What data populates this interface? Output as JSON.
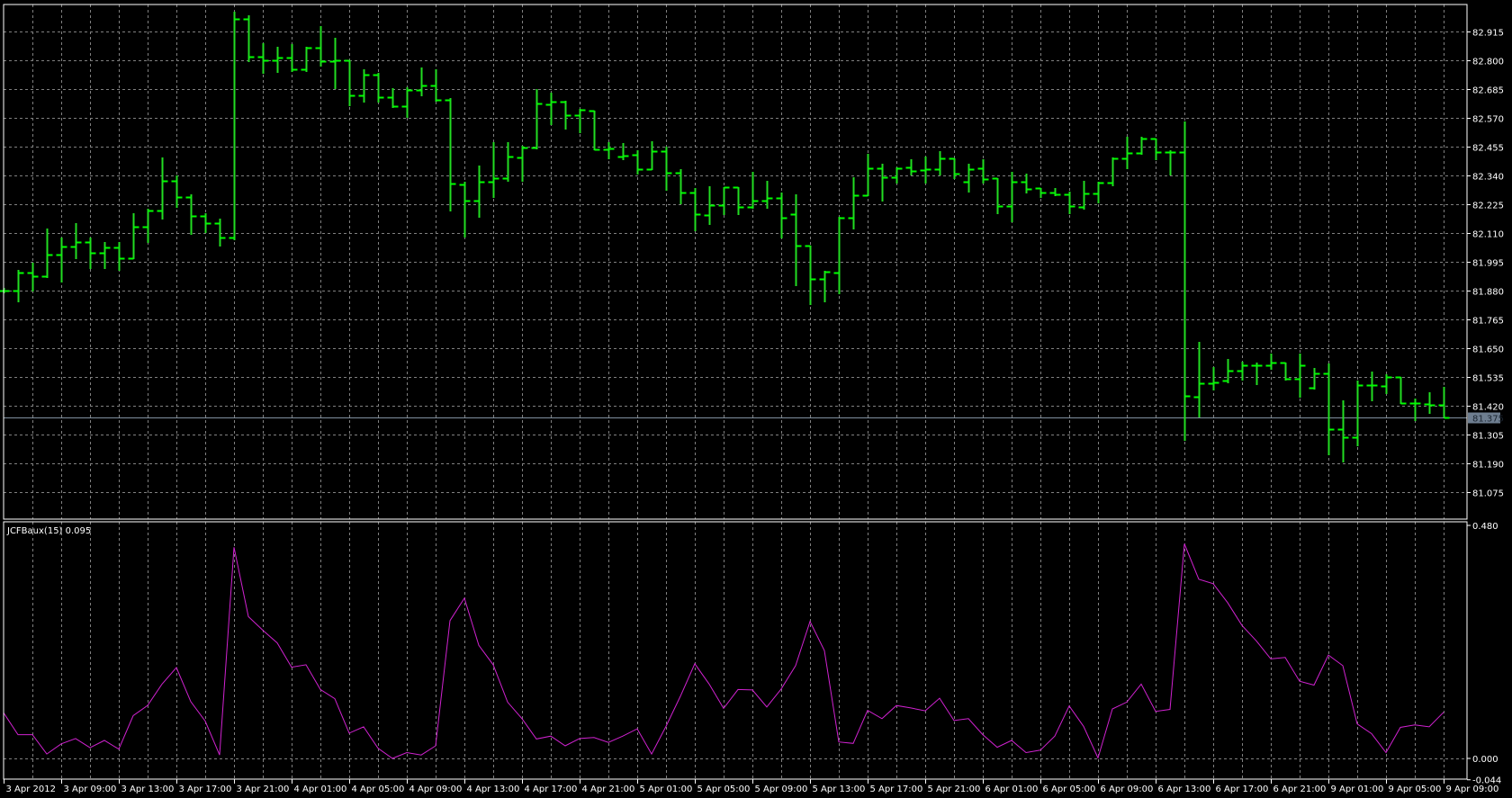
{
  "colors": {
    "background": "#000000",
    "grid": "#808080",
    "frame": "#ffffff",
    "bars": "#22dd22",
    "indicator": "#d022d0",
    "current_price_bg": "#6e7e90",
    "current_price_line": "#8090a0"
  },
  "chart_data": [
    {
      "type": "ohlc",
      "title": "",
      "price_axis": {
        "range": [
          81.0,
          82.99
        ],
        "ticks": [
          "82.915",
          "82.800",
          "82.685",
          "82.570",
          "82.455",
          "82.340",
          "82.225",
          "82.110",
          "81.995",
          "81.880",
          "81.765",
          "81.650",
          "81.535",
          "81.420",
          "81.305",
          "81.190",
          "81.075"
        ],
        "current_price": "81.375"
      },
      "time_axis": {
        "bar_interval": "1 hour",
        "labels": [
          "3 Apr 2012",
          "3 Apr 09:00",
          "3 Apr 13:00",
          "3 Apr 17:00",
          "3 Apr 21:00",
          "4 Apr 01:00",
          "4 Apr 05:00",
          "4 Apr 09:00",
          "4 Apr 13:00",
          "4 Apr 17:00",
          "4 Apr 21:00",
          "5 Apr 01:00",
          "5 Apr 05:00",
          "5 Apr 09:00",
          "5 Apr 13:00",
          "5 Apr 17:00",
          "5 Apr 21:00",
          "6 Apr 01:00",
          "6 Apr 05:00",
          "6 Apr 09:00",
          "6 Apr 13:00",
          "6 Apr 17:00",
          "6 Apr 21:00",
          "9 Apr 01:00",
          "9 Apr 05:00",
          "9 Apr 09:00"
        ],
        "label_every_bars": 4
      },
      "ohlc": [
        [
          81.88,
          81.891,
          81.873,
          81.88
        ],
        [
          81.88,
          81.963,
          81.837,
          81.952
        ],
        [
          81.952,
          81.991,
          81.88,
          81.938
        ],
        [
          81.938,
          82.128,
          81.934,
          82.024
        ],
        [
          82.024,
          82.092,
          81.916,
          82.056
        ],
        [
          82.056,
          82.15,
          82.009,
          82.074
        ],
        [
          82.074,
          82.092,
          81.97,
          82.031
        ],
        [
          82.031,
          82.074,
          81.97,
          82.053
        ],
        [
          82.053,
          82.074,
          81.963,
          82.009
        ],
        [
          82.009,
          82.189,
          82.009,
          82.135
        ],
        [
          82.135,
          82.207,
          82.074,
          82.2
        ],
        [
          82.2,
          82.412,
          82.168,
          82.318
        ],
        [
          82.318,
          82.34,
          82.214,
          82.254
        ],
        [
          82.254,
          82.265,
          82.106,
          82.178
        ],
        [
          82.178,
          82.189,
          82.114,
          82.15
        ],
        [
          82.15,
          82.168,
          82.06,
          82.092
        ],
        [
          82.092,
          82.994,
          82.085,
          82.965
        ],
        [
          82.965,
          82.98,
          82.796,
          82.814
        ],
        [
          82.814,
          82.868,
          82.75,
          82.8
        ],
        [
          82.8,
          82.854,
          82.753,
          82.811
        ],
        [
          82.811,
          82.865,
          82.757,
          82.764
        ],
        [
          82.764,
          82.854,
          82.757,
          82.85
        ],
        [
          82.85,
          82.937,
          82.778,
          82.796
        ],
        [
          82.796,
          82.89,
          82.689,
          82.8
        ],
        [
          82.8,
          82.8,
          82.62,
          82.66
        ],
        [
          82.66,
          82.764,
          82.635,
          82.743
        ],
        [
          82.743,
          82.75,
          82.635,
          82.653
        ],
        [
          82.653,
          82.689,
          82.613,
          82.617
        ],
        [
          82.617,
          82.692,
          82.574,
          82.681
        ],
        [
          82.681,
          82.771,
          82.66,
          82.699
        ],
        [
          82.699,
          82.764,
          82.638,
          82.642
        ],
        [
          82.642,
          82.649,
          82.2,
          82.308
        ],
        [
          82.304,
          82.315,
          82.096,
          82.239
        ],
        [
          82.239,
          82.38,
          82.175,
          82.315
        ],
        [
          82.315,
          82.473,
          82.254,
          82.329
        ],
        [
          82.329,
          82.473,
          82.318,
          82.416
        ],
        [
          82.412,
          82.459,
          82.318,
          82.451
        ],
        [
          82.451,
          82.685,
          82.448,
          82.628
        ],
        [
          82.624,
          82.671,
          82.545,
          82.635
        ],
        [
          82.635,
          82.638,
          82.527,
          82.581
        ],
        [
          82.581,
          82.606,
          82.513,
          82.602
        ],
        [
          82.599,
          82.599,
          82.444,
          82.444
        ],
        [
          82.444,
          82.473,
          82.408,
          82.448
        ],
        [
          82.416,
          82.469,
          82.405,
          82.419
        ],
        [
          82.423,
          82.441,
          82.347,
          82.365
        ],
        [
          82.365,
          82.477,
          82.365,
          82.437
        ],
        [
          82.437,
          82.455,
          82.283,
          82.351
        ],
        [
          82.351,
          82.365,
          82.229,
          82.272
        ],
        [
          82.272,
          82.29,
          82.121,
          82.186
        ],
        [
          82.182,
          82.297,
          82.146,
          82.221
        ],
        [
          82.221,
          82.293,
          82.186,
          82.293
        ],
        [
          82.293,
          82.293,
          82.186,
          82.214
        ],
        [
          82.214,
          82.354,
          82.211,
          82.239
        ],
        [
          82.239,
          82.318,
          82.211,
          82.25
        ],
        [
          82.25,
          82.272,
          82.092,
          82.171
        ],
        [
          82.186,
          82.265,
          81.902,
          82.06
        ],
        [
          82.06,
          82.06,
          81.826,
          81.927
        ],
        [
          81.927,
          81.959,
          81.837,
          81.956
        ],
        [
          81.952,
          82.175,
          81.869,
          82.171
        ],
        [
          82.171,
          82.333,
          82.128,
          82.261
        ],
        [
          82.261,
          82.426,
          82.261,
          82.369
        ],
        [
          82.369,
          82.387,
          82.239,
          82.333
        ],
        [
          82.333,
          82.372,
          82.311,
          82.369
        ],
        [
          82.372,
          82.405,
          82.344,
          82.358
        ],
        [
          82.362,
          82.416,
          82.311,
          82.365
        ],
        [
          82.365,
          82.437,
          82.344,
          82.408
        ],
        [
          82.408,
          82.408,
          82.329,
          82.347
        ],
        [
          82.315,
          82.387,
          82.275,
          82.365
        ],
        [
          82.369,
          82.405,
          82.311,
          82.326
        ],
        [
          82.329,
          82.329,
          82.189,
          82.218
        ],
        [
          82.218,
          82.354,
          82.157,
          82.315
        ],
        [
          82.315,
          82.347,
          82.272,
          82.286
        ],
        [
          82.29,
          82.29,
          82.254,
          82.272
        ],
        [
          82.272,
          82.29,
          82.261,
          82.265
        ],
        [
          82.265,
          82.275,
          82.189,
          82.218
        ],
        [
          82.214,
          82.318,
          82.207,
          82.268
        ],
        [
          82.268,
          82.315,
          82.232,
          82.311
        ],
        [
          82.311,
          82.412,
          82.3,
          82.408
        ],
        [
          82.408,
          82.495,
          82.369,
          82.43
        ],
        [
          82.43,
          82.495,
          82.426,
          82.487
        ],
        [
          82.487,
          82.487,
          82.405,
          82.433
        ],
        [
          82.433,
          82.441,
          82.344,
          82.433
        ],
        [
          82.433,
          82.556,
          81.283,
          81.46
        ],
        [
          81.456,
          81.675,
          81.377,
          81.51
        ],
        [
          81.51,
          81.575,
          81.485,
          81.513
        ],
        [
          81.521,
          81.607,
          81.513,
          81.56
        ],
        [
          81.56,
          81.596,
          81.524,
          81.582
        ],
        [
          81.582,
          81.592,
          81.506,
          81.582
        ],
        [
          81.582,
          81.628,
          81.567,
          81.592
        ],
        [
          81.592,
          81.592,
          81.524,
          81.528
        ],
        [
          81.528,
          81.628,
          81.456,
          81.582
        ],
        [
          81.492,
          81.571,
          81.488,
          81.549
        ],
        [
          81.549,
          81.589,
          81.226,
          81.327
        ],
        [
          81.327,
          81.442,
          81.197,
          81.294
        ],
        [
          81.294,
          81.521,
          81.262,
          81.503
        ],
        [
          81.503,
          81.557,
          81.442,
          81.503
        ],
        [
          81.499,
          81.546,
          81.47,
          81.535
        ],
        [
          81.535,
          81.535,
          81.431,
          81.431
        ],
        [
          81.431,
          81.449,
          81.363,
          81.431
        ],
        [
          81.427,
          81.474,
          81.391,
          81.424
        ],
        [
          81.424,
          81.496,
          81.377,
          81.375
        ]
      ]
    },
    {
      "type": "line",
      "title": "JCFBaux(15) 0.095",
      "ylim": [
        -0.044,
        0.48
      ],
      "ticks": [
        "0.480",
        "0.000",
        "-0.044"
      ],
      "values": [
        0.094,
        0.049,
        0.049,
        0.009,
        0.03,
        0.041,
        0.022,
        0.037,
        0.019,
        0.088,
        0.109,
        0.153,
        0.187,
        0.117,
        0.077,
        0.007,
        0.435,
        0.292,
        0.264,
        0.238,
        0.188,
        0.193,
        0.142,
        0.123,
        0.052,
        0.065,
        0.021,
        0.0,
        0.012,
        0.007,
        0.026,
        0.284,
        0.33,
        0.233,
        0.193,
        0.116,
        0.082,
        0.04,
        0.046,
        0.026,
        0.041,
        0.043,
        0.033,
        0.046,
        0.061,
        0.009,
        0.066,
        0.128,
        0.195,
        0.153,
        0.103,
        0.142,
        0.141,
        0.106,
        0.143,
        0.191,
        0.282,
        0.222,
        0.034,
        0.031,
        0.099,
        0.082,
        0.109,
        0.104,
        0.098,
        0.124,
        0.078,
        0.082,
        0.049,
        0.023,
        0.037,
        0.012,
        0.017,
        0.046,
        0.108,
        0.066,
        0.001,
        0.102,
        0.116,
        0.153,
        0.097,
        0.101,
        0.442,
        0.369,
        0.36,
        0.321,
        0.274,
        0.242,
        0.205,
        0.208,
        0.159,
        0.151,
        0.213,
        0.191,
        0.071,
        0.051,
        0.012,
        0.064,
        0.069,
        0.065,
        0.095
      ]
    }
  ]
}
